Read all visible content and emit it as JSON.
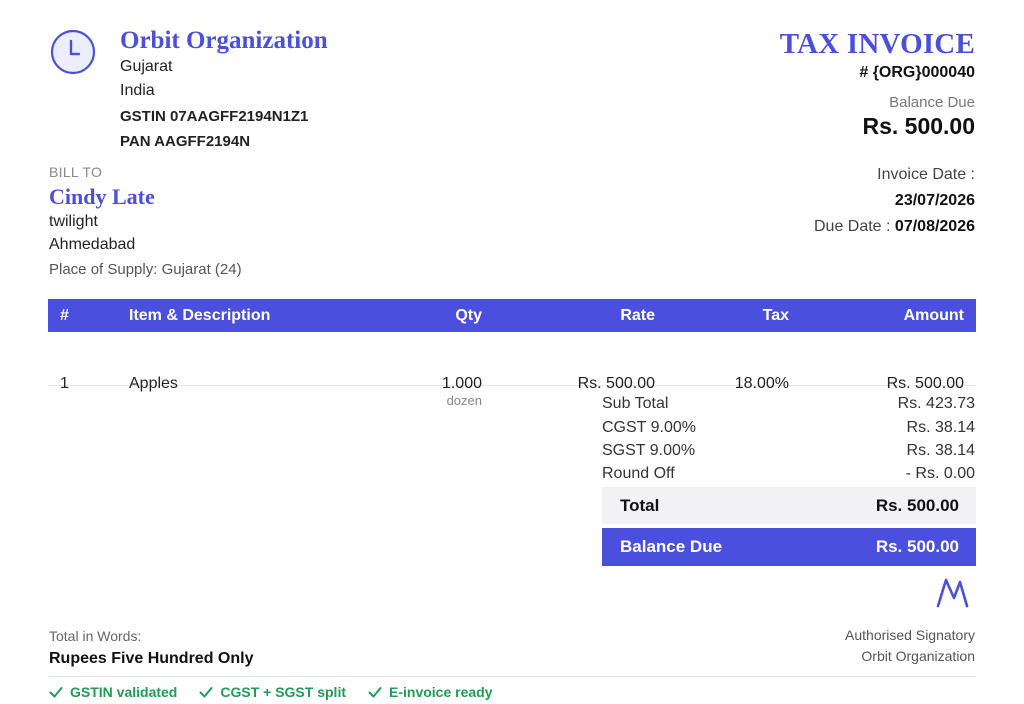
{
  "org": {
    "name": "Orbit Organization",
    "state": "Gujarat",
    "country": "India",
    "gstin": "GSTIN 07AAGFF2194N1Z1",
    "pan": "PAN AAGFF2194N",
    "logo_icon": "clock-icon"
  },
  "invoice": {
    "title": "TAX INVOICE",
    "number": "# {ORG}000040",
    "balance_due_label": "Balance Due",
    "balance_due": "Rs. 500.00",
    "date_label": "Invoice Date :",
    "date": "23/07/2026",
    "due_date_label": "Due Date : ",
    "due_date": "07/08/2026"
  },
  "bill_to": {
    "label": "BILL TO",
    "name": "Cindy Late",
    "line1": "twilight",
    "line2": "Ahmedabad",
    "place_of_supply": "Place of Supply: Gujarat (24)"
  },
  "table": {
    "headers": [
      "#",
      "Item & Description",
      "Qty",
      "Rate",
      "Tax",
      "Amount"
    ],
    "rows": [
      {
        "num": "1",
        "item": "Apples",
        "qty": "1.000",
        "unit": "dozen",
        "rate": "Rs. 500.00",
        "tax": "18.00%",
        "amount": "Rs. 500.00"
      }
    ]
  },
  "totals": {
    "subtotal_label": "Sub Total",
    "subtotal": "Rs. 423.73",
    "cgst_label": "CGST 9.00%",
    "cgst": "Rs. 38.14",
    "sgst_label": "SGST 9.00%",
    "sgst": "Rs. 38.14",
    "roundoff_label": "Round Off",
    "roundoff": "- Rs. 0.00",
    "total_label": "Total",
    "total": "Rs. 500.00",
    "balance_due_label": "Balance Due",
    "balance_due": "Rs. 500.00"
  },
  "footer": {
    "words_label": "Total in Words:",
    "words": "Rupees Five Hundred Only",
    "signatory": "Authorised Signatory",
    "signatory_org": "Orbit Organization",
    "checks": [
      "GSTIN validated",
      "CGST + SGST split",
      "E-invoice ready"
    ]
  },
  "colors": {
    "accent": "#4a4fdd",
    "success": "#1f9d55"
  }
}
